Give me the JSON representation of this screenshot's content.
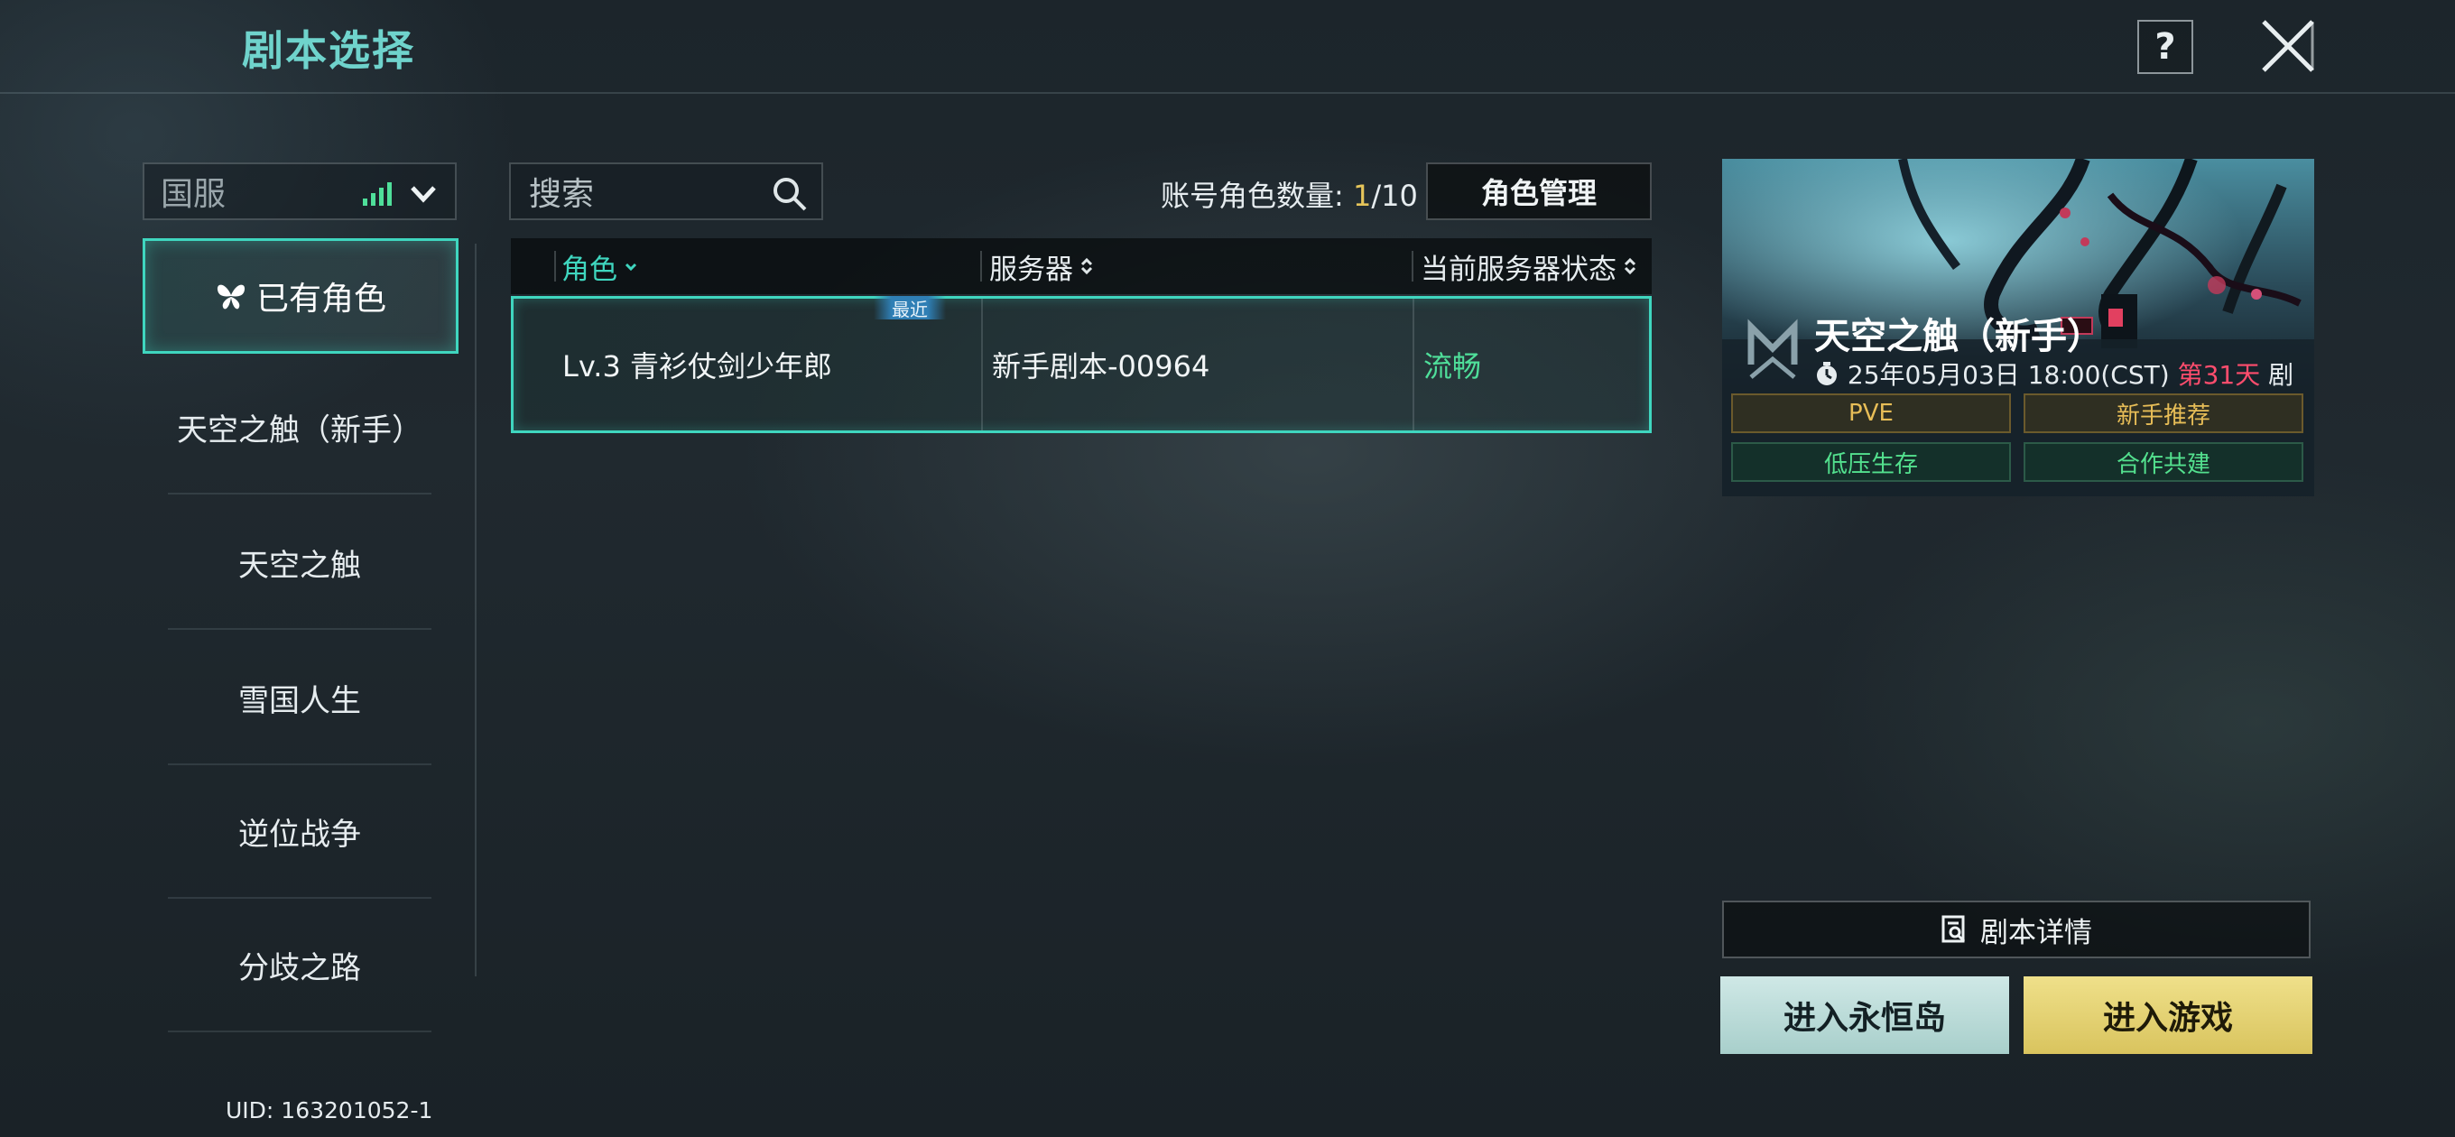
{
  "header": {
    "title": "剧本选择",
    "help_label": "?"
  },
  "left_panel": {
    "server_select": "国服",
    "nav_active": "已有角色",
    "nav_items": [
      "天空之触（新手）",
      "天空之触",
      "雪国人生",
      "逆位战争",
      "分歧之路"
    ],
    "uid": "UID: 163201052-1"
  },
  "toolbar": {
    "search_placeholder": "搜索",
    "count_label": "账号角色数量: ",
    "count_current": "1",
    "count_total": "/10",
    "manage_button": "角色管理"
  },
  "table": {
    "columns": [
      "角色",
      "服务器",
      "当前服务器状态"
    ],
    "rows": [
      {
        "character": "Lv.3 青衫仗剑少年郎",
        "server": "新手剧本-00964",
        "status": "流畅",
        "tag": "最近"
      }
    ]
  },
  "card": {
    "title": "天空之触（新手）",
    "time": "25年05月03日 18:00(CST) ",
    "day": "第31天",
    "time_suffix": " 剧",
    "tags": [
      "PVE",
      "新手推荐",
      "低压生存",
      "合作共建"
    ]
  },
  "actions": {
    "detail": "剧本详情",
    "enter_island": "进入永恒岛",
    "enter_game": "进入游戏"
  },
  "colors": {
    "accent": "#3fd6bf",
    "title": "#6fd3cc",
    "status_ok": "#4fdf9a",
    "gold": "#e7bd57",
    "day_red": "#ff4d6d"
  },
  "icons": [
    "help-icon",
    "close-icon",
    "signal-icon",
    "chevron-down-icon",
    "search-icon",
    "butterfly-icon",
    "sort-icon",
    "clock-icon",
    "game-logo-icon",
    "document-icon"
  ]
}
